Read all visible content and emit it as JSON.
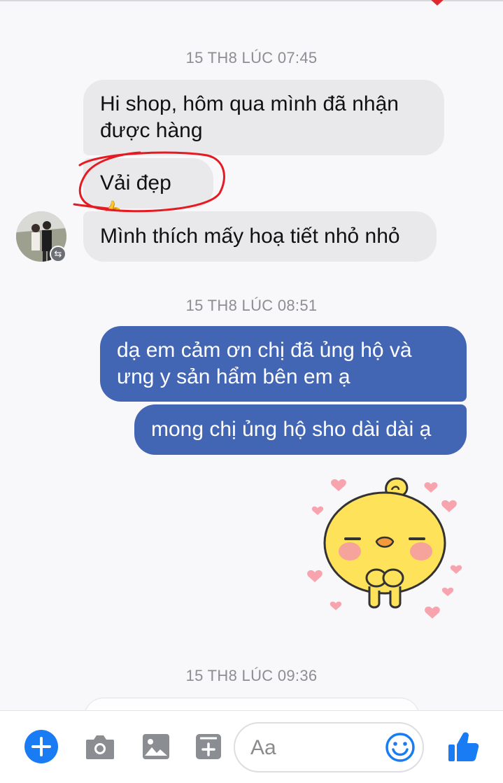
{
  "conversation": {
    "timestamps": [
      "15 TH8 LÚC 07:45",
      "15 TH8 LÚC 08:51",
      "15 TH8 LÚC 09:36"
    ],
    "incoming": [
      {
        "line1": "Hi shop, hôm qua mình đã nhận",
        "line2": "được hàng"
      },
      {
        "text": "Vải đẹp",
        "emoji": "👍"
      },
      {
        "text": "Mình thích mấy hoạ tiết nhỏ nhỏ"
      }
    ],
    "outgoing": [
      {
        "line1": "dạ em cảm ơn chị đã ủng hộ và",
        "line2": "ưng y sản hẩm bên em ạ"
      },
      {
        "text": "mong chị ủng hộ sho dài dài ạ"
      }
    ]
  },
  "composer": {
    "placeholder": "Aa",
    "icons": [
      "plus-icon",
      "camera-icon",
      "image-icon",
      "sticker-icon",
      "emoji-icon",
      "like-icon"
    ]
  },
  "colors": {
    "incoming_bubble": "#e9e9eb",
    "outgoing_bubble": "#4366b4",
    "accent": "#1a7cf5",
    "annotation": "#e41b23"
  }
}
